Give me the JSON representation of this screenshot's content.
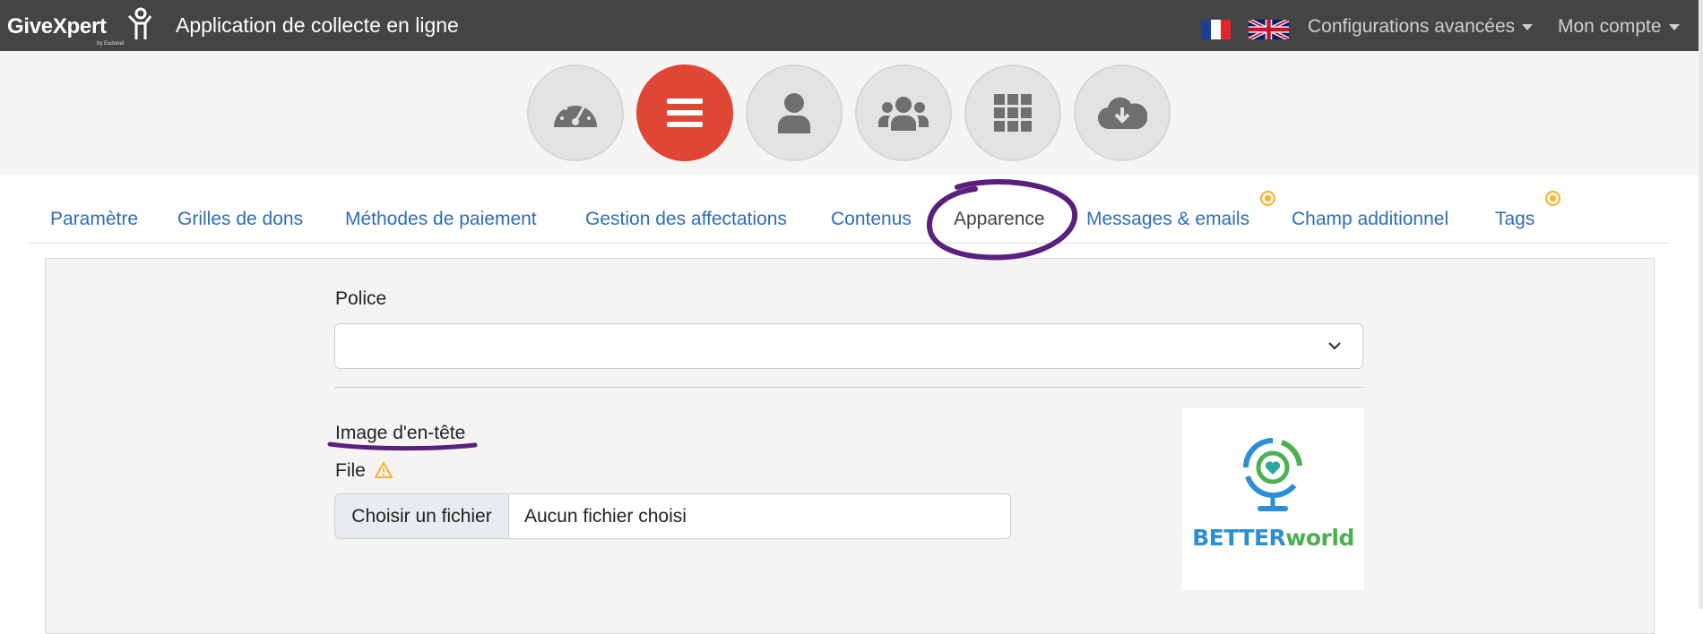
{
  "header": {
    "logo_text": "GiveXpert",
    "logo_sub": "by Eudonet",
    "app_title": "Application de collecte en ligne",
    "menu_advanced": "Configurations avancées",
    "menu_account": "Mon compte"
  },
  "steps": [
    {
      "icon": "dashboard-icon",
      "active": false
    },
    {
      "icon": "menu-icon",
      "active": true
    },
    {
      "icon": "user-icon",
      "active": false
    },
    {
      "icon": "users-icon",
      "active": false
    },
    {
      "icon": "grid-icon",
      "active": false
    },
    {
      "icon": "cloud-download-icon",
      "active": false
    }
  ],
  "tabs": [
    {
      "label": "Paramètre"
    },
    {
      "label": "Grilles de dons"
    },
    {
      "label": "Méthodes de paiement"
    },
    {
      "label": "Gestion des affectations"
    },
    {
      "label": "Contenus"
    },
    {
      "label": "Apparence",
      "active": true
    },
    {
      "label": "Messages & emails",
      "indicator": true
    },
    {
      "label": "Champ additionnel"
    },
    {
      "label": "Tags",
      "indicator": true
    }
  ],
  "form": {
    "font_label": "Police",
    "font_value": "",
    "header_image_label": "Image d'en-tête",
    "file_label": "File",
    "choose_file": "Choisir un fichier",
    "no_file": "Aucun fichier choisi"
  },
  "preview": {
    "brand_a": "BETTER",
    "brand_b": "world"
  },
  "colors": {
    "topbar": "#444444",
    "active_step": "#df4636",
    "link": "#2f6db3",
    "annotation": "#5b1f7d",
    "indicator": "#f5b330"
  }
}
